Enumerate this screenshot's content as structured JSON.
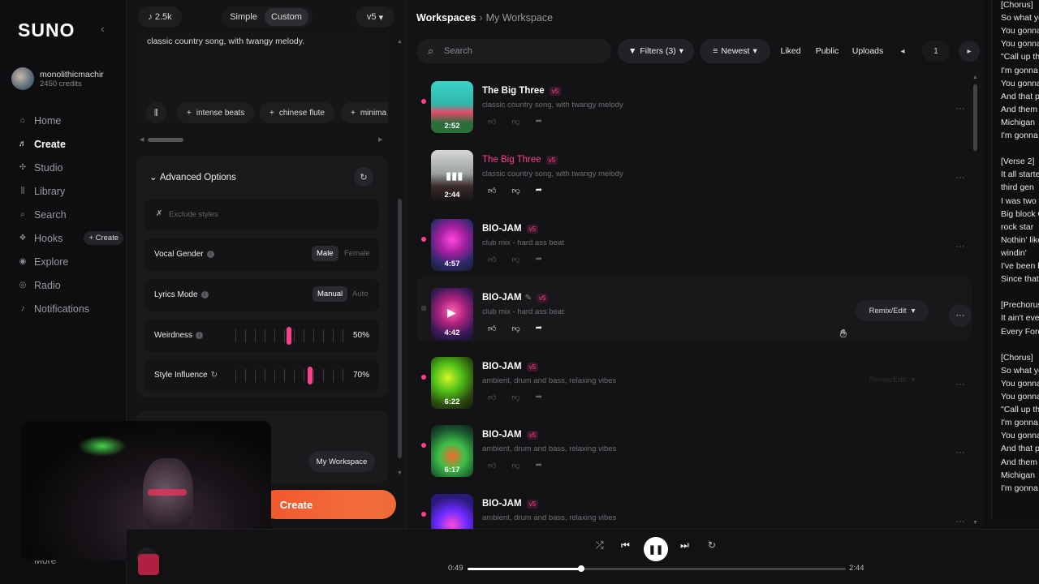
{
  "sidebar": {
    "logo": "SUNO",
    "collapse_icon": "‹",
    "user": {
      "name": "monolithicmachir",
      "credits": "2450 credits"
    },
    "items": [
      {
        "label": "Home",
        "icon": "⌂"
      },
      {
        "label": "Create",
        "icon": "♬"
      },
      {
        "label": "Studio",
        "icon": "✣"
      },
      {
        "label": "Library",
        "icon": "⫼"
      },
      {
        "label": "Search",
        "icon": "⌕"
      },
      {
        "label": "Hooks",
        "icon": "❖"
      },
      {
        "label": "Explore",
        "icon": "◉"
      },
      {
        "label": "Radio",
        "icon": "◎"
      },
      {
        "label": "Notifications",
        "icon": "♪"
      }
    ],
    "hooks_create": "+ Create",
    "more": "More"
  },
  "create": {
    "plays": "2.5k",
    "mode_simple": "Simple",
    "mode_custom": "Custom",
    "version": "v5",
    "prompt": "classic country song, with twangy melody.",
    "chips": [
      "intense beats",
      "chinese flute",
      "minima"
    ],
    "advanced_title": "Advanced Options",
    "exclude_placeholder": "Exclude styles",
    "vocal_gender": {
      "label": "Vocal Gender",
      "selected": "Male",
      "other": "Female"
    },
    "lyrics_mode": {
      "label": "Lyrics Mode",
      "selected": "Manual",
      "other": "Auto"
    },
    "weirdness": {
      "label": "Weirdness",
      "value": "50%",
      "level": 0.5
    },
    "style_influence": {
      "label": "Style Influence",
      "value": "70%",
      "level": 0.7
    },
    "workspace_button": "My Workspace",
    "create_button": "Create"
  },
  "main": {
    "breadcrumb_root": "Workspaces",
    "breadcrumb_current": "My Workspace",
    "search_placeholder": "Search",
    "filters_label": "Filters (3)",
    "sort_label": "Newest",
    "liked": "Liked",
    "public": "Public",
    "uploads": "Uploads",
    "page": "1",
    "remix_label": "Remix/Edit",
    "songs": [
      {
        "title": "The Big Three",
        "badge": "v5",
        "desc": "classic country song, with twangy melody",
        "duration": "2:52"
      },
      {
        "title": "The Big Three",
        "badge": "v5",
        "desc": "classic country song, with twangy melody",
        "duration": "2:44"
      },
      {
        "title": "BIO-JAM",
        "badge": "v5",
        "desc": "club mix - hard ass beat",
        "duration": "4:57"
      },
      {
        "title": "BIO-JAM",
        "badge": "v5",
        "desc": "club mix - hard ass beat",
        "duration": "4:42"
      },
      {
        "title": "BIO-JAM",
        "badge": "v5",
        "desc": "ambient, drum and bass, relaxing vibes",
        "duration": "6:22"
      },
      {
        "title": "BIO-JAM",
        "badge": "v5",
        "desc": "ambient, drum and bass, relaxing vibes",
        "duration": "6:17"
      },
      {
        "title": "BIO-JAM",
        "badge": "v5",
        "desc": "ambient, drum and bass, relaxing vibes",
        "duration": ""
      }
    ]
  },
  "lyrics": [
    "[Chorus]",
    "So what yo",
    "You gonna",
    "You gonna",
    "\"Call up th",
    "I'm gonna",
    "You gonna",
    "And that p",
    "And them p",
    "Michigan",
    "I'm gonna",
    "",
    "[Verse 2]",
    "It all starte",
    "third gen",
    "I was two v",
    "Big block C",
    "rock star",
    "Nothin' like",
    "windin'",
    "I've been b",
    "Since that",
    "",
    "[Prechorus",
    "It ain't eve",
    "Every Ford",
    "",
    "[Chorus]",
    "So what yo",
    "You gonna",
    "You gonna",
    "\"Call up the",
    "I'm gonna",
    "You gonna",
    "And that p",
    "And them p",
    "Michigan",
    "I'm gonna"
  ],
  "player": {
    "elapsed": "0:49",
    "total": "2:44",
    "progress": 0.3
  },
  "colors": {
    "accent": "#ff3e8d",
    "create_button": "#f0572a"
  }
}
